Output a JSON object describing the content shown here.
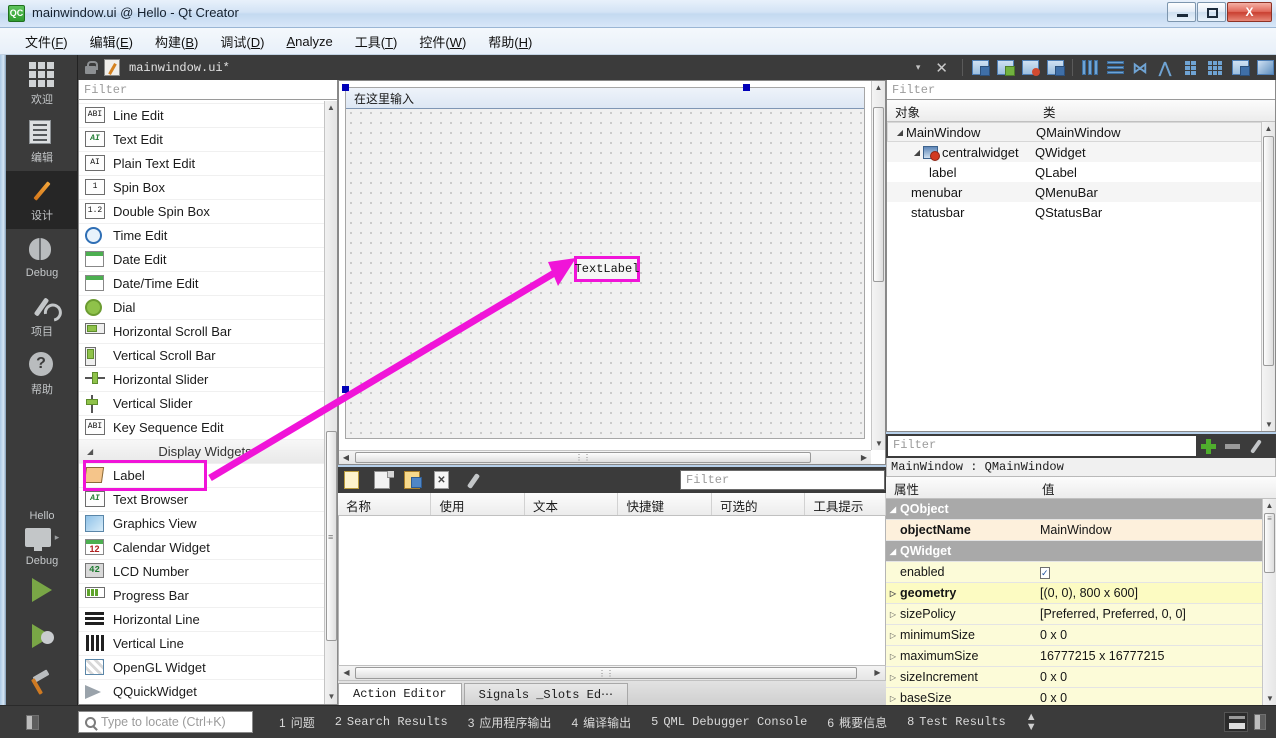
{
  "window": {
    "title": "mainwindow.ui @ Hello - Qt Creator",
    "app_icon": "QC",
    "minimize_label": "Minimize",
    "maximize_label": "Maximize",
    "close_label": "X"
  },
  "menubar": {
    "items": [
      {
        "label": "文件(F)",
        "mnemonic": "F"
      },
      {
        "label": "编辑(E)",
        "mnemonic": "E"
      },
      {
        "label": "构建(B)",
        "mnemonic": "B"
      },
      {
        "label": "调试(D)",
        "mnemonic": "D"
      },
      {
        "label": "Analyze",
        "mnemonic": "A"
      },
      {
        "label": "工具(T)",
        "mnemonic": "T"
      },
      {
        "label": "控件(W)",
        "mnemonic": "W"
      },
      {
        "label": "帮助(H)",
        "mnemonic": "H"
      }
    ]
  },
  "modebar": {
    "modes": [
      {
        "label": "欢迎",
        "icon": "grid-icon"
      },
      {
        "label": "编辑",
        "icon": "document-icon"
      },
      {
        "label": "设计",
        "icon": "pencil-icon",
        "active": true
      },
      {
        "label": "Debug",
        "icon": "bug-icon"
      },
      {
        "label": "项目",
        "icon": "wrench-icon"
      },
      {
        "label": "帮助",
        "icon": "question-icon"
      }
    ],
    "run_config": {
      "project": "Hello",
      "kit_icon": "monitor-icon",
      "build_config": "Debug",
      "run_label": "Run",
      "debug_label": "Start Debugging",
      "build_label": "Build"
    }
  },
  "designtoolbar": {
    "lock_icon": "unlocked-icon",
    "file_icon": "ui-file-icon",
    "filename": "mainwindow.ui*",
    "dropdown_icon": "chevron-down-icon",
    "close_icon": "close-icon",
    "buttons": [
      {
        "name": "edit-widgets-button",
        "icon": "widget-edit-icon"
      },
      {
        "name": "edit-signals-slots-button",
        "icon": "signals-slots-icon"
      },
      {
        "name": "edit-buddies-button",
        "icon": "buddies-icon"
      },
      {
        "name": "edit-tab-order-button",
        "icon": "tab-order-icon"
      },
      {
        "name": "layout-horizontally-button",
        "icon": "layout-horizontal-icon"
      },
      {
        "name": "layout-vertically-button",
        "icon": "layout-vertical-icon"
      },
      {
        "name": "layout-splitter-horizontal-button",
        "icon": "splitter-h-icon"
      },
      {
        "name": "layout-splitter-vertical-button",
        "icon": "splitter-v-icon"
      },
      {
        "name": "layout-form-button",
        "icon": "form-layout-icon"
      },
      {
        "name": "layout-grid-button",
        "icon": "grid-layout-icon"
      },
      {
        "name": "break-layout-button",
        "icon": "break-layout-icon"
      },
      {
        "name": "adjust-size-button",
        "icon": "adjust-size-icon"
      }
    ]
  },
  "widgetbox": {
    "filter_placeholder": "Filter",
    "items": [
      {
        "label": "Line Edit",
        "icon": "line-edit-icon",
        "partial": false
      },
      {
        "label": "Text Edit",
        "icon": "text-edit-icon"
      },
      {
        "label": "Plain Text Edit",
        "icon": "plain-text-edit-icon"
      },
      {
        "label": "Spin Box",
        "icon": "spin-box-icon"
      },
      {
        "label": "Double Spin Box",
        "icon": "double-spin-box-icon"
      },
      {
        "label": "Time Edit",
        "icon": "time-edit-icon"
      },
      {
        "label": "Date Edit",
        "icon": "date-edit-icon"
      },
      {
        "label": "Date/Time Edit",
        "icon": "date-time-edit-icon"
      },
      {
        "label": "Dial",
        "icon": "dial-icon"
      },
      {
        "label": "Horizontal Scroll Bar",
        "icon": "horizontal-scroll-bar-icon"
      },
      {
        "label": "Vertical Scroll Bar",
        "icon": "vertical-scroll-bar-icon"
      },
      {
        "label": "Horizontal Slider",
        "icon": "horizontal-slider-icon"
      },
      {
        "label": "Vertical Slider",
        "icon": "vertical-slider-icon"
      },
      {
        "label": "Key Sequence Edit",
        "icon": "key-sequence-edit-icon"
      },
      {
        "label": "Display Widgets",
        "icon": "collapse-triangle-icon",
        "is_header": true
      },
      {
        "label": "Label",
        "icon": "label-icon",
        "highlighted": true
      },
      {
        "label": "Text Browser",
        "icon": "text-browser-icon"
      },
      {
        "label": "Graphics View",
        "icon": "graphics-view-icon"
      },
      {
        "label": "Calendar Widget",
        "icon": "calendar-widget-icon"
      },
      {
        "label": "LCD Number",
        "icon": "lcd-number-icon"
      },
      {
        "label": "Progress Bar",
        "icon": "progress-bar-icon"
      },
      {
        "label": "Horizontal Line",
        "icon": "horizontal-line-icon"
      },
      {
        "label": "Vertical Line",
        "icon": "vertical-line-icon"
      },
      {
        "label": "OpenGL Widget",
        "icon": "opengl-widget-icon"
      },
      {
        "label": "QQuickWidget",
        "icon": "qquickwidget-icon"
      }
    ],
    "lcd_glyph": "42",
    "calendar_glyph": "12",
    "spin_glyph": "1",
    "double_spin_glyph": "1.2",
    "line_edit_glyph": "ABI",
    "text_edit_glyph": "AI"
  },
  "form": {
    "menubar_placeholder": "在这里输入",
    "selected_widget_text": "TextLabel",
    "accent_highlight": "#f014d8"
  },
  "actioneditor": {
    "filter_placeholder": "Filter",
    "toolbar_buttons": [
      {
        "name": "new-action-button",
        "icon": "new-page-icon"
      },
      {
        "name": "copy-action-button",
        "icon": "copy-page-icon"
      },
      {
        "name": "edit-action-button",
        "icon": "edit-page-icon"
      },
      {
        "name": "delete-action-button",
        "icon": "delete-page-icon"
      },
      {
        "name": "view-options-button",
        "icon": "wrench-icon"
      }
    ],
    "columns": [
      "名称",
      "使用",
      "文本",
      "快捷键",
      "可选的",
      "工具提示"
    ],
    "rows": [],
    "tabs": [
      {
        "label": "Action Editor",
        "active": true
      },
      {
        "label": "Signals _Slots Ed⋯",
        "active": false
      }
    ]
  },
  "objectinspector": {
    "filter_placeholder": "Filter",
    "columns": [
      "对象",
      "类"
    ],
    "rows": [
      {
        "object": "MainWindow",
        "class": "QMainWindow",
        "depth": 0,
        "expander": true,
        "selected": true
      },
      {
        "object": "centralwidget",
        "class": "QWidget",
        "depth": 1,
        "expander": true,
        "icon": "widget-icon"
      },
      {
        "object": "label",
        "class": "QLabel",
        "depth": 2
      },
      {
        "object": "menubar",
        "class": "QMenuBar",
        "depth": 1
      },
      {
        "object": "statusbar",
        "class": "QStatusBar",
        "depth": 1
      }
    ]
  },
  "propertyeditor": {
    "filter_placeholder": "Filter",
    "add_button_label": "+",
    "remove_button_label": "−",
    "config_button_label": "configure",
    "object_header": "MainWindow : QMainWindow",
    "columns": [
      "属性",
      "值"
    ],
    "rows": [
      {
        "name": "QObject",
        "value": "",
        "group": true
      },
      {
        "name": "objectName",
        "value": "MainWindow",
        "bold": true,
        "style": "hl"
      },
      {
        "name": "QWidget",
        "value": "",
        "group": true
      },
      {
        "name": "enabled",
        "value": "",
        "checkbox": true,
        "checked": true,
        "style": "yel"
      },
      {
        "name": "geometry",
        "value": "[(0, 0), 800 x 600]",
        "bold": true,
        "expander": true,
        "style": "yel2"
      },
      {
        "name": "sizePolicy",
        "value": "[Preferred, Preferred, 0, 0]",
        "expander": true,
        "style": "yel"
      },
      {
        "name": "minimumSize",
        "value": "0 x 0",
        "expander": true,
        "style": "yel"
      },
      {
        "name": "maximumSize",
        "value": "16777215 x 16777215",
        "expander": true,
        "style": "yel"
      },
      {
        "name": "sizeIncrement",
        "value": "0 x 0",
        "expander": true,
        "style": "yel"
      },
      {
        "name": "baseSize",
        "value": "0 x 0",
        "expander": true,
        "style": "yel"
      }
    ]
  },
  "statusbar": {
    "locate_placeholder": "Type to locate (Ctrl+K)",
    "search_icon": "magnifier-icon",
    "panes": [
      {
        "num": "1",
        "label": "问题",
        "cjk": true
      },
      {
        "num": "2",
        "label": "Search Results",
        "cjk": false
      },
      {
        "num": "3",
        "label": "应用程序输出",
        "cjk": true
      },
      {
        "num": "4",
        "label": "编译输出",
        "cjk": true
      },
      {
        "num": "5",
        "label": "QML Debugger Console",
        "cjk": false
      },
      {
        "num": "6",
        "label": "概要信息",
        "cjk": true
      },
      {
        "num": "8",
        "label": "Test Results",
        "cjk": false
      }
    ],
    "updown_icon": "up-down-arrows-icon",
    "progress_icon": "progress-details-icon",
    "sidebar_toggle_icon": "toggle-sidebar-icon"
  }
}
